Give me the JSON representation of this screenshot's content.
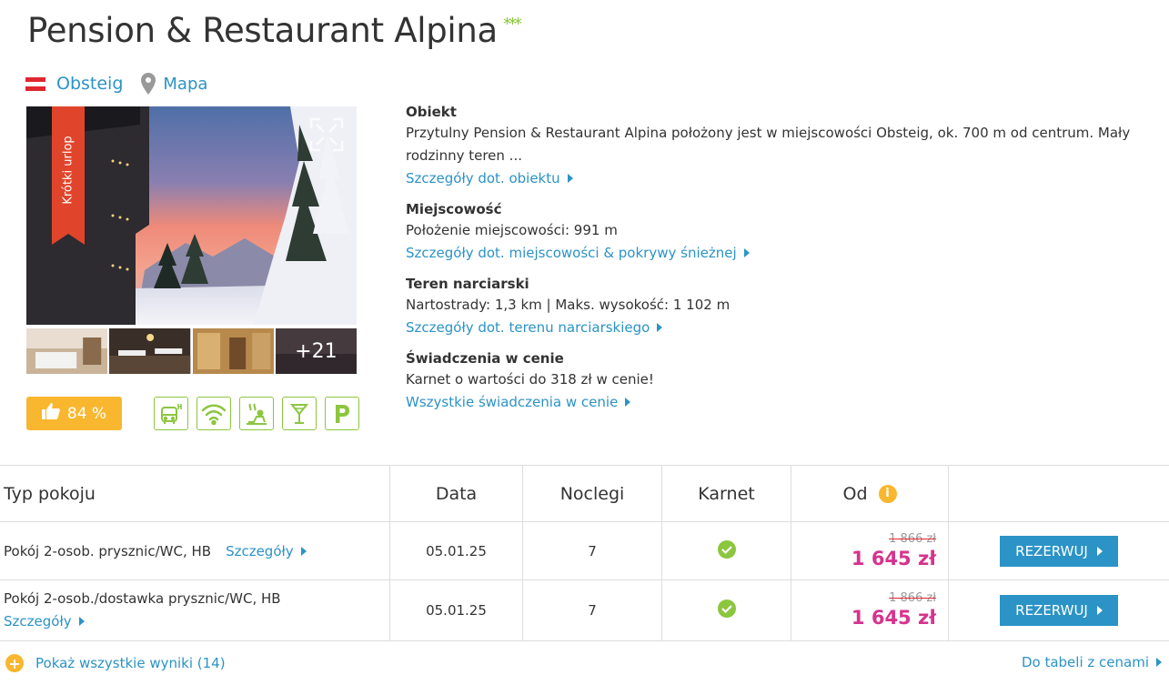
{
  "hotel": {
    "name": "Pension & Restaurant Alpina",
    "stars": "***",
    "location": "Obsteig",
    "map_label": "Mapa",
    "ribbon": "Krótki urlop",
    "more_photos": "+21",
    "rating": "84 %"
  },
  "amenities": [
    "bus-icon",
    "wifi-icon",
    "sauna-icon",
    "bar-icon",
    "parking-icon"
  ],
  "info": {
    "obiekt": {
      "title": "Obiekt",
      "text": "Przytulny Pension & Restaurant Alpina położony jest w miejscowości Obsteig, ok. 700 m od centrum. Mały rodzinny teren ...",
      "link": "Szczegóły dot. obiektu"
    },
    "miejscowosc": {
      "title": "Miejscowość",
      "text": "Położenie miejscowości: 991 m",
      "link": "Szczegóły dot. miejscowości & pokrywy śnieżnej"
    },
    "teren": {
      "title": "Teren narciarski",
      "text": "Nartostrady: 1,3 km | Maks. wysokość: 1 102 m",
      "link": "Szczegóły dot. terenu narciarskiego"
    },
    "swiadczenia": {
      "title": "Świadczenia w cenie",
      "text": "Karnet o wartości do 318 zł w cenie!",
      "link": "Wszystkie świadczenia w cenie"
    }
  },
  "table": {
    "headers": {
      "room": "Typ pokoju",
      "date": "Data",
      "nights": "Noclegi",
      "pass": "Karnet",
      "from": "Od"
    },
    "rows": [
      {
        "room": "Pokój 2-osob. prysznic/WC, HB",
        "details": "Szczegóły",
        "date": "05.01.25",
        "nights": "7",
        "old_price": "1 866 zł",
        "price": "1 645 zł",
        "button": "REZERWUJ"
      },
      {
        "room": "Pokój 2-osob./dostawka prysznic/WC, HB",
        "details": "Szczegóły",
        "date": "05.01.25",
        "nights": "7",
        "old_price": "1 866 zł",
        "price": "1 645 zł",
        "button": "REZERWUJ"
      }
    ]
  },
  "footer": {
    "show_all": "Pokaż wszystkie wyniki (14)",
    "to_table": "Do tabeli z cenami"
  },
  "colors": {
    "link": "#2b93c6",
    "price": "#d6338e",
    "accent": "#f9b72f",
    "green": "#8cc63f"
  }
}
